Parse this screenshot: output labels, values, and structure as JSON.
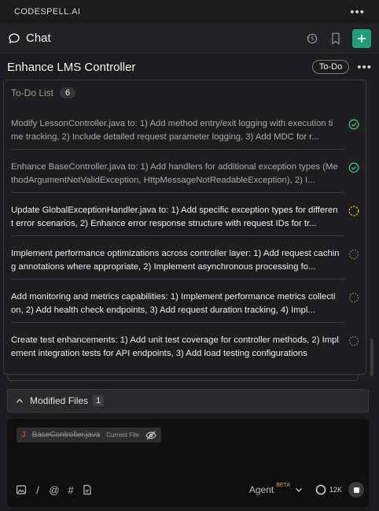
{
  "app": {
    "brand": "CODESPELL.AI",
    "menu_icon": "more-horizontal-icon"
  },
  "chat_header": {
    "title": "Chat",
    "icons": [
      "chat-bubble-icon",
      "history-icon",
      "bookmark-icon",
      "plus-icon"
    ],
    "accent_color": "#1f9e7a"
  },
  "conversation": {
    "title": "Enhance LMS Controller",
    "status_badge": "To-Do"
  },
  "todo": {
    "label": "To-Do List",
    "count": "6",
    "items": [
      {
        "text": "Modify LessonController.java to: 1) Add method entry/exit logging with execution time tracking, 2) Include detailed request parameter logging, 3) Add MDC for r...",
        "status": "done"
      },
      {
        "text": "Enhance BaseController.java to: 1) Add handlers for additional exception types (MethodArgumentNotValidException, HttpMessageNotReadableException), 2) I...",
        "status": "done"
      },
      {
        "text": "Update GlobalExceptionHandler.java to: 1) Add specific exception types for different error scenarios, 2) Enhance error response structure with request IDs for tr...",
        "status": "in-progress"
      },
      {
        "text": "Implement performance optimizations across controller layer: 1) Add request caching annotations where appropriate, 2) Implement asynchronous processing fo...",
        "status": "pending"
      },
      {
        "text": "Add monitoring and metrics capabilities: 1) Implement performance metrics collection, 2) Add health check endpoints, 3) Add request duration tracking, 4) Impl...",
        "status": "pending"
      },
      {
        "text": "Create test enhancements: 1) Add unit test coverage for controller methods, 2) Implement integration tests for API endpoints, 3) Add load testing configurations",
        "status": "pending"
      }
    ],
    "status_colors": {
      "done": "#3fbf7f",
      "in-progress": "#d9b43a",
      "pending": "#8a8a8a"
    }
  },
  "modified_files": {
    "label": "Modified Files",
    "count": "1"
  },
  "composer": {
    "file_chip": {
      "type_letter": "J",
      "name": "BaseController.java",
      "tag": "Current File"
    },
    "tools": [
      "image-icon",
      "slash-icon",
      "at-icon",
      "hash-icon",
      "file-icon"
    ],
    "tool_glyphs": [
      "/",
      "@",
      "#"
    ],
    "mode": "Agent",
    "mode_tag": "BETA",
    "context": "12K"
  }
}
